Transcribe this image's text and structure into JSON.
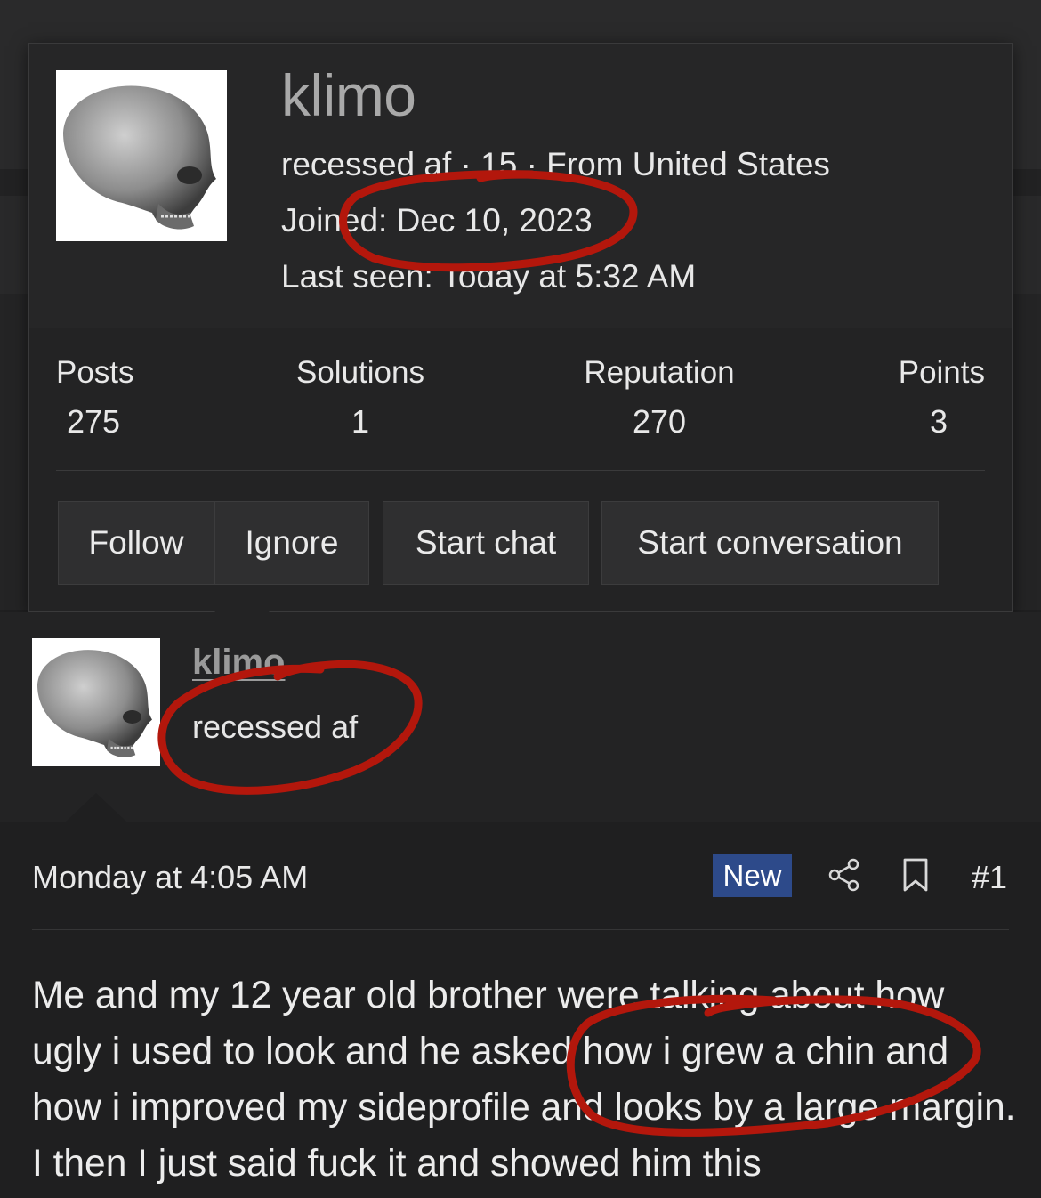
{
  "popup": {
    "username": "klimo",
    "info_line": "recessed af · 15 · From United States",
    "joined": "Joined: Dec 10, 2023",
    "last_seen": "Last seen: Today at 5:32 AM",
    "stats": [
      {
        "label": "Posts",
        "value": "275"
      },
      {
        "label": "Solutions",
        "value": "1"
      },
      {
        "label": "Reputation",
        "value": "270"
      },
      {
        "label": "Points",
        "value": "3"
      }
    ],
    "buttons": {
      "follow": "Follow",
      "ignore": "Ignore",
      "start_chat": "Start chat",
      "start_conversation": "Start conversation"
    }
  },
  "post": {
    "username": "klimo",
    "user_title": "recessed af",
    "date": "Monday at 4:05 AM",
    "badge": "New",
    "post_number": "#1",
    "body": "Me and my 12 year old brother were talking about how ugly i used to look and he asked how i grew a chin and how i improved my sideprofile and looks by a large margin. I then I just said fuck it and showed him this"
  },
  "colors": {
    "background": "#1f1f20",
    "card": "#232324",
    "badge_new": "#2d4a8a",
    "annotation_red": "#b3170c"
  },
  "icons": [
    "skull-avatar",
    "share-icon",
    "bookmark-icon"
  ]
}
